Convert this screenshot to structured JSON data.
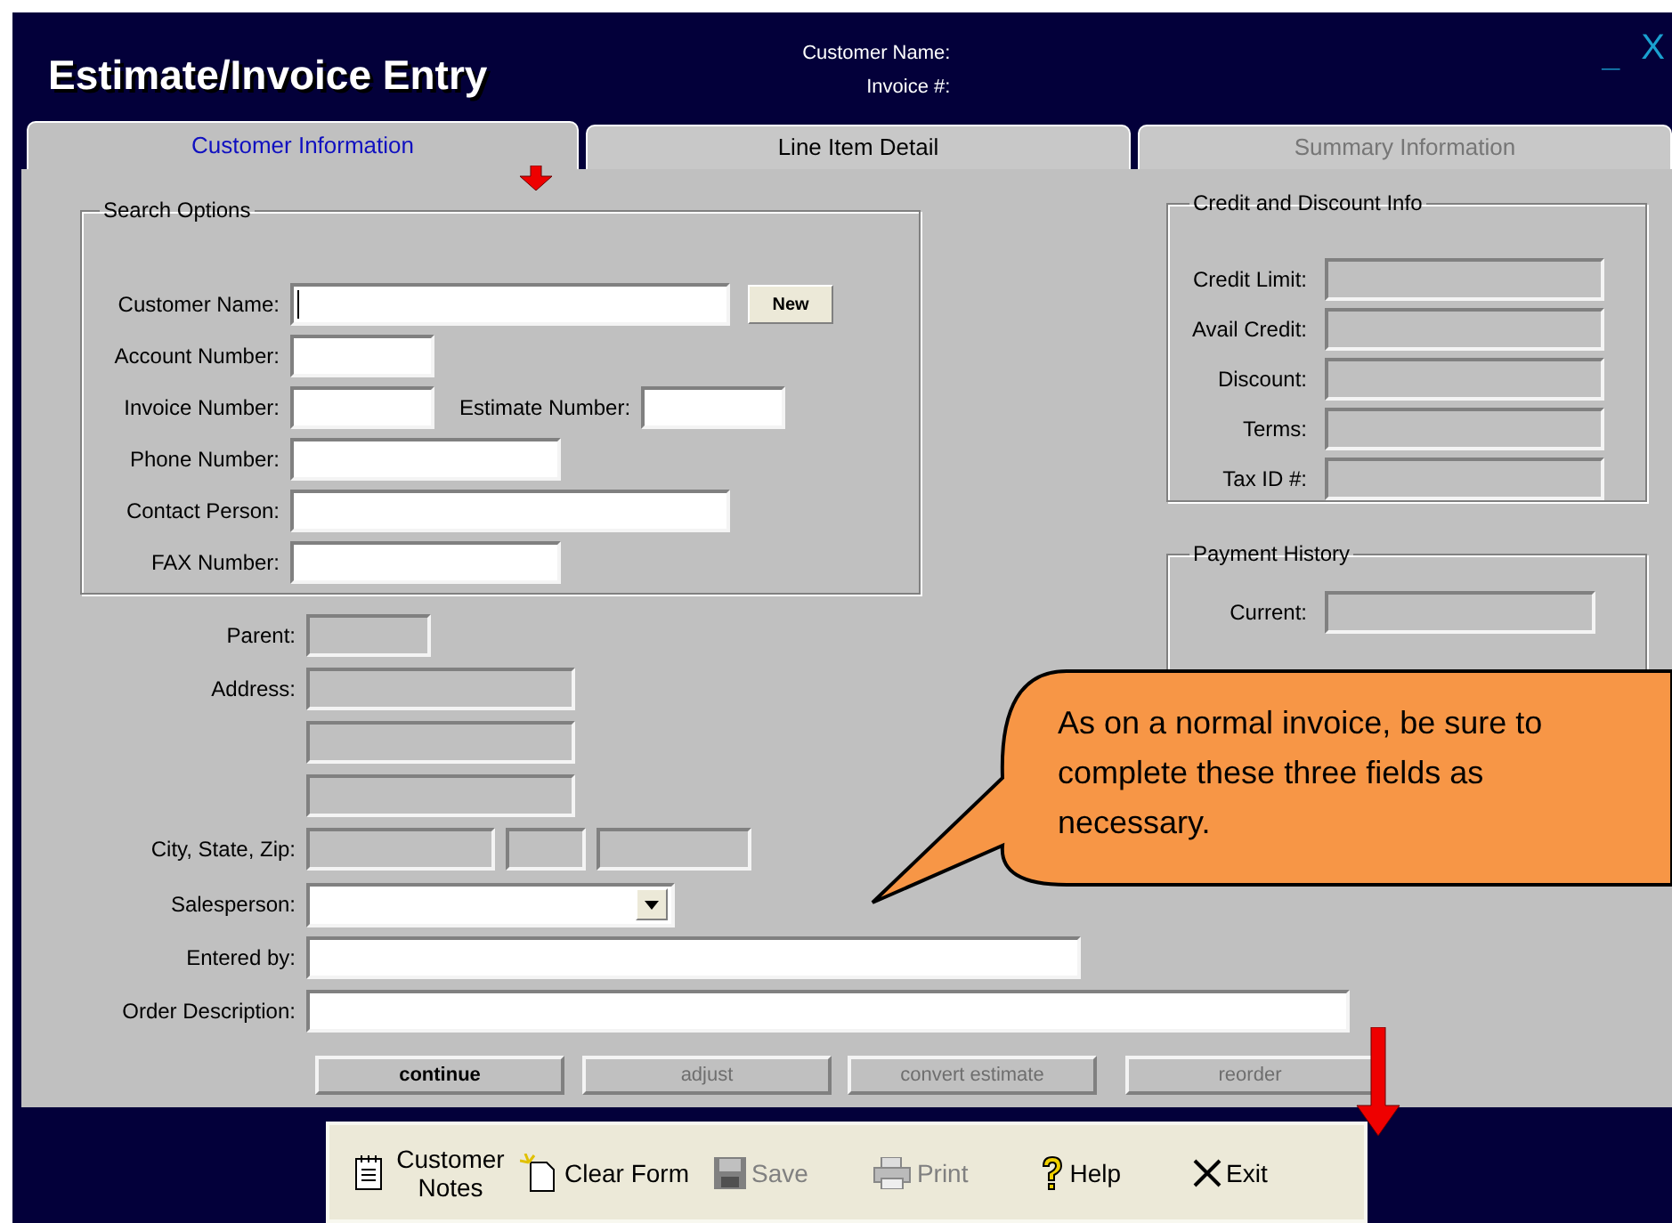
{
  "window": {
    "title": "Estimate/Invoice Entry",
    "header_labels": [
      "Customer Name:",
      "Invoice #:"
    ],
    "minimize": "_",
    "close": "X"
  },
  "tabs": [
    {
      "label": "Customer Information",
      "selected": true,
      "disabled": false
    },
    {
      "label": "Line Item Detail",
      "selected": false,
      "disabled": false
    },
    {
      "label": "Summary Information",
      "selected": false,
      "disabled": true
    }
  ],
  "search_options": {
    "title": "Search Options",
    "new_button": "New",
    "fields": [
      {
        "label": "Customer Name:",
        "disabled": false,
        "focused": true
      },
      {
        "label": "Account Number:",
        "disabled": false,
        "focused": false
      },
      {
        "label": "Invoice Number:",
        "disabled": false,
        "focused": false
      },
      {
        "label": "Estimate Number:",
        "disabled": false,
        "focused": false
      },
      {
        "label": "Phone Number:",
        "disabled": false,
        "focused": false
      },
      {
        "label": "Contact Person:",
        "disabled": false,
        "focused": false
      },
      {
        "label": "FAX Number:",
        "disabled": false,
        "focused": false
      }
    ]
  },
  "address_fields": [
    {
      "label": "Parent:",
      "disabled": true
    },
    {
      "label": "Address:",
      "disabled": true
    },
    {
      "disabled": true
    },
    {
      "disabled": true
    },
    {
      "label": "City, State, Zip:",
      "disabled": true
    },
    {
      "disabled": true
    },
    {
      "disabled": true
    }
  ],
  "credit_info": {
    "title": "Credit and Discount Info",
    "fields": [
      {
        "label": "Credit Limit:",
        "disabled": true
      },
      {
        "label": "Avail Credit:",
        "disabled": true
      },
      {
        "label": "Discount:",
        "disabled": true
      },
      {
        "label": "Terms:",
        "disabled": true
      },
      {
        "label": "Tax ID #:",
        "disabled": true
      }
    ]
  },
  "payment_history": {
    "title": "Payment History",
    "fields": [
      {
        "label": "Current:",
        "disabled": true
      }
    ]
  },
  "order_fields": [
    {
      "label": "Salesperson:",
      "kind": "dropdown"
    },
    {
      "label": "Entered by:",
      "kind": "text"
    },
    {
      "label": "Order Description:",
      "kind": "text"
    }
  ],
  "actions": [
    {
      "label": "continue",
      "disabled": false
    },
    {
      "label": "adjust",
      "disabled": true
    },
    {
      "label": "convert estimate",
      "disabled": true
    },
    {
      "label": "reorder",
      "disabled": true
    }
  ],
  "toolbar": [
    {
      "label": "Customer Notes",
      "kind": "notes",
      "disabled": false
    },
    {
      "label": "Clear Form",
      "kind": "clear",
      "disabled": false
    },
    {
      "label": "Save",
      "kind": "save",
      "disabled": true
    },
    {
      "label": "Print",
      "kind": "print",
      "disabled": true
    },
    {
      "label": "Help",
      "kind": "help",
      "disabled": false
    },
    {
      "label": "Exit",
      "kind": "exit",
      "disabled": false
    }
  ],
  "callout": {
    "text": "As on a normal invoice, be sure to complete these three fields as necessary."
  }
}
